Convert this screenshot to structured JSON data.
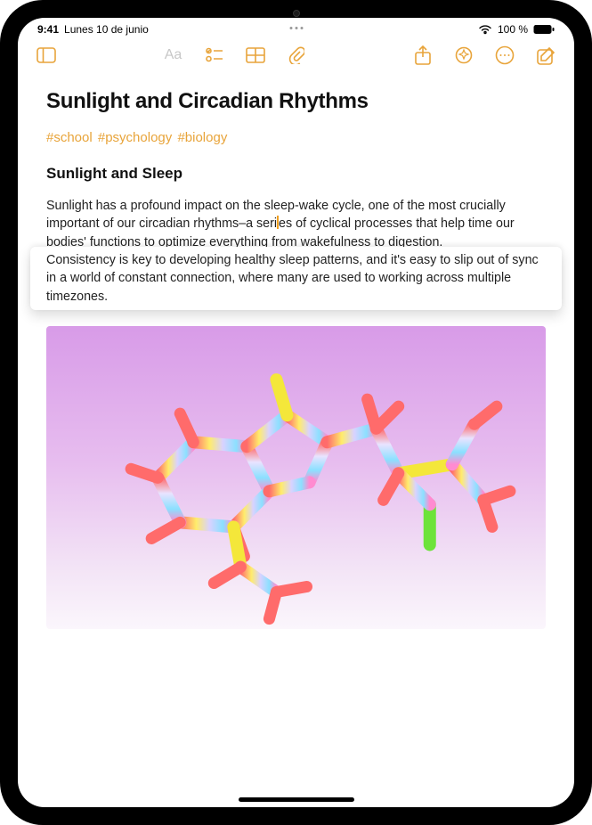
{
  "status": {
    "time": "9:41",
    "date": "Lunes 10 de junio",
    "battery_pct": "100 %"
  },
  "toolbar": {
    "sidebar": "sidebar",
    "format": "Aa",
    "checklist": "checklist",
    "table": "table",
    "attach": "attach",
    "share": "share",
    "lock": "lock",
    "more": "more",
    "compose": "compose"
  },
  "note": {
    "title": "Sunlight and Circadian Rhythms",
    "tags": [
      "#school",
      "#psychology",
      "#biology"
    ],
    "subheading": "Sunlight and Sleep",
    "body_before_caret": "Sunlight has a profound impact on the sleep-wake cycle, one of the most crucially important of our circadian rhythms–a seri",
    "body_after_caret": "es of cyclical processes that help time our bodies' functions to optimize everything from wakefulness to digestion.",
    "body_highlight": "Consistency is key to developing healthy sleep patterns, and it's easy to slip out of sync in a world of constant connection, where many are used to working across multiple timezones."
  }
}
